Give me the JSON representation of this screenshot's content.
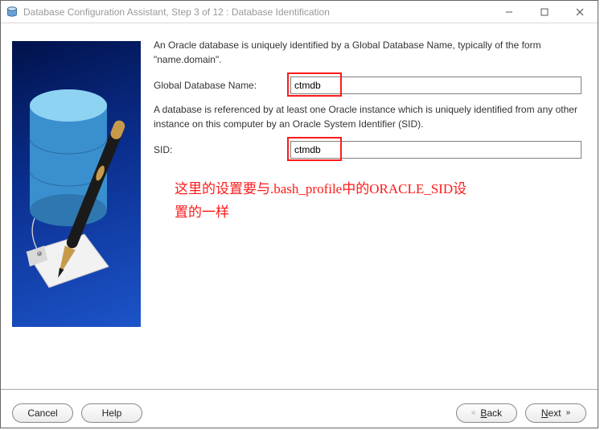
{
  "titlebar": {
    "title": "Database Configuration Assistant, Step 3 of 12 : Database Identification"
  },
  "form": {
    "intro": "An Oracle database is uniquely identified by a Global Database Name, typically of the form \"name.domain\".",
    "global_db_label": "Global Database Name:",
    "global_db_value": "ctmdb",
    "desc2": "A database is referenced by at least one Oracle instance which is uniquely identified from any other instance on this computer by an Oracle System Identifier (SID).",
    "sid_label": "SID:",
    "sid_value": "ctmdb"
  },
  "annotation": "这里的设置要与.bash_profile中的ORACLE_SID设置的一样",
  "buttons": {
    "cancel": "Cancel",
    "help": "Help",
    "back_prefix": "B",
    "back_rest": "ack",
    "next_prefix": "N",
    "next_rest": "ext"
  }
}
